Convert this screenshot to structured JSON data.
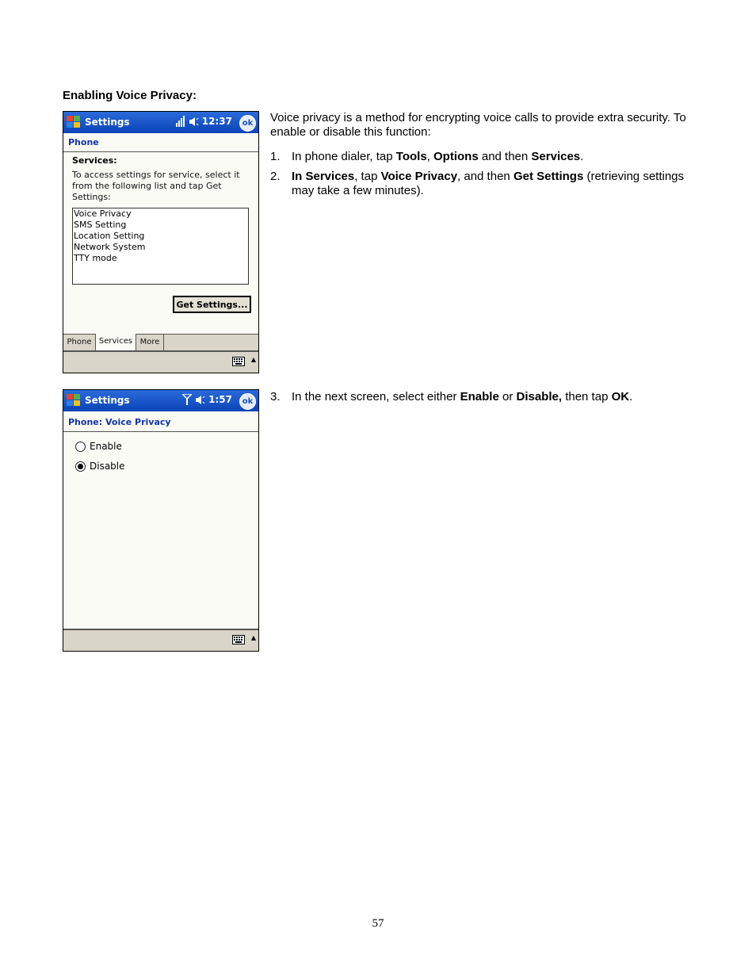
{
  "heading": "Enabling Voice Privacy:",
  "intro": "Voice privacy is a method for encrypting voice calls to provide extra security. To enable or disable this function:",
  "steps": {
    "s1": {
      "num": "1.",
      "t1": "In phone dialer, tap ",
      "b1": "Tools",
      "t2": ", ",
      "b2": "Options",
      "t3": " and then ",
      "b3": "Services",
      "t4": "."
    },
    "s2": {
      "num": "2.",
      "b1": "In Services",
      "t1": ", tap ",
      "b2": "Voice Privacy",
      "t2": ", and then ",
      "b3": "Get Settings",
      "t3": " (retrieving settings may take a few minutes)."
    },
    "s3": {
      "num": "3.",
      "t1": "In the next screen, select either ",
      "b1": "Enable",
      "t2": " or ",
      "b2": "Disable,",
      "t3": " then tap ",
      "b3": "OK",
      "t4": "."
    }
  },
  "screen1": {
    "title": "Settings",
    "clock": "12:37",
    "ok_label": "ok",
    "header": "Phone",
    "services_label": "Services:",
    "description": "To access settings for service, select it from the following list and tap Get Settings:",
    "list_items": [
      "Voice Privacy",
      "SMS Setting",
      "Location Setting",
      "Network System",
      "TTY mode"
    ],
    "button_label": "Get Settings...",
    "tabs": [
      "Phone",
      "Services",
      "More"
    ]
  },
  "screen2": {
    "title": "Settings",
    "clock": "1:57",
    "ok_label": "ok",
    "header": "Phone: Voice Privacy",
    "options": [
      "Enable",
      "Disable"
    ],
    "selected": "Disable"
  },
  "page_number": "57"
}
